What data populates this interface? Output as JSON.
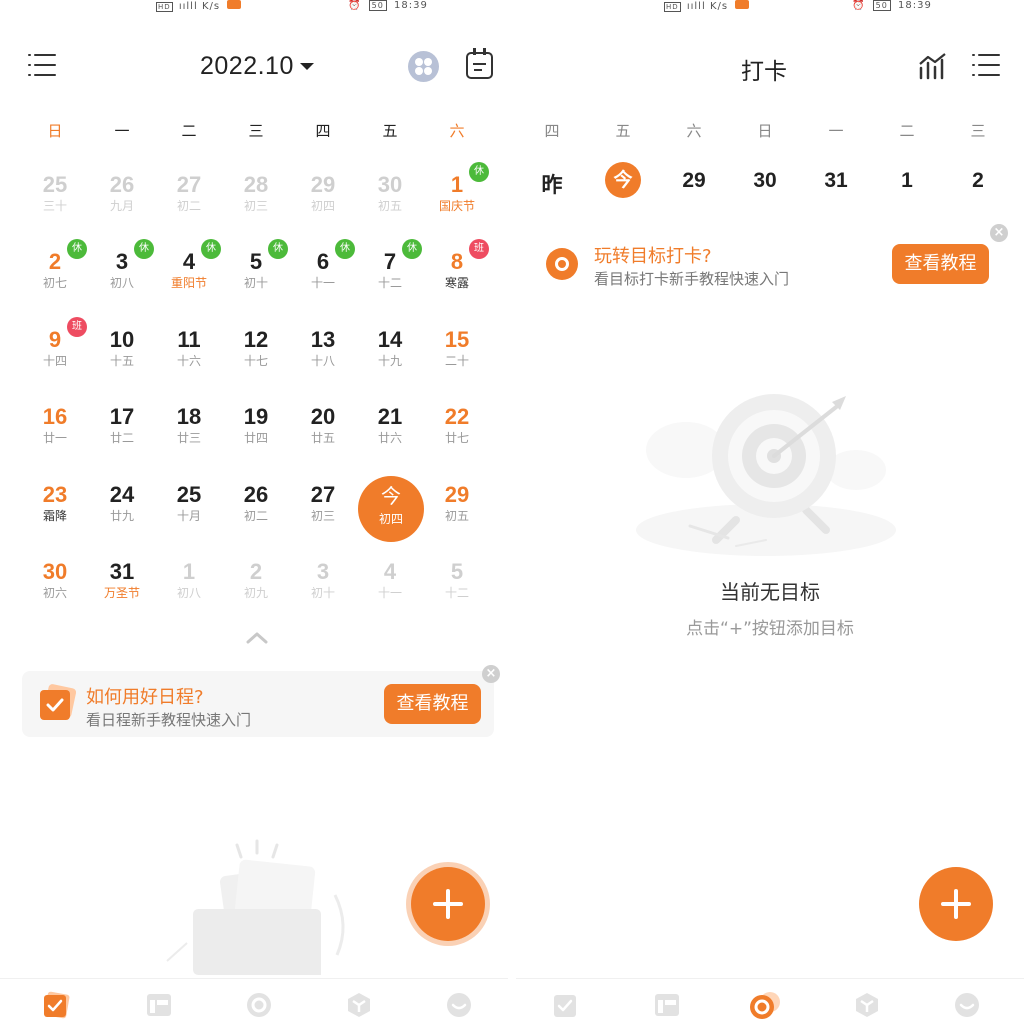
{
  "left": {
    "status": {
      "hd": "HD",
      "signal": "ıılll",
      "speed": "K/s",
      "battery": "50",
      "time": "18:39"
    },
    "header": {
      "month": "2022.10"
    },
    "weekdays": [
      "日",
      "一",
      "二",
      "三",
      "四",
      "五",
      "六"
    ],
    "weeks": [
      [
        {
          "n": "25",
          "s": "三十",
          "t": "other"
        },
        {
          "n": "26",
          "s": "九月",
          "t": "other"
        },
        {
          "n": "27",
          "s": "初二",
          "t": "other"
        },
        {
          "n": "28",
          "s": "初三",
          "t": "other"
        },
        {
          "n": "29",
          "s": "初四",
          "t": "other"
        },
        {
          "n": "30",
          "s": "初五",
          "t": "other"
        },
        {
          "n": "1",
          "s": "国庆节",
          "t": "weekend",
          "hl": true,
          "badge": "休"
        }
      ],
      [
        {
          "n": "2",
          "s": "初七",
          "t": "weekend",
          "badge": "休"
        },
        {
          "n": "3",
          "s": "初八",
          "t": "",
          "badge": "休"
        },
        {
          "n": "4",
          "s": "重阳节",
          "t": "",
          "hl": true,
          "badge": "休"
        },
        {
          "n": "5",
          "s": "初十",
          "t": "",
          "badge": "休"
        },
        {
          "n": "6",
          "s": "十一",
          "t": "",
          "badge": "休"
        },
        {
          "n": "7",
          "s": "十二",
          "t": "",
          "badge": "休"
        },
        {
          "n": "8",
          "s": "寒露",
          "t": "weekend",
          "term": true,
          "badge": "班",
          "badgeType": "work"
        }
      ],
      [
        {
          "n": "9",
          "s": "十四",
          "t": "weekend",
          "badge": "班",
          "badgeType": "work"
        },
        {
          "n": "10",
          "s": "十五",
          "t": ""
        },
        {
          "n": "11",
          "s": "十六",
          "t": ""
        },
        {
          "n": "12",
          "s": "十七",
          "t": ""
        },
        {
          "n": "13",
          "s": "十八",
          "t": ""
        },
        {
          "n": "14",
          "s": "十九",
          "t": ""
        },
        {
          "n": "15",
          "s": "二十",
          "t": "weekend"
        }
      ],
      [
        {
          "n": "16",
          "s": "廿一",
          "t": "weekend"
        },
        {
          "n": "17",
          "s": "廿二",
          "t": ""
        },
        {
          "n": "18",
          "s": "廿三",
          "t": ""
        },
        {
          "n": "19",
          "s": "廿四",
          "t": ""
        },
        {
          "n": "20",
          "s": "廿五",
          "t": ""
        },
        {
          "n": "21",
          "s": "廿六",
          "t": ""
        },
        {
          "n": "22",
          "s": "廿七",
          "t": "weekend"
        }
      ],
      [
        {
          "n": "23",
          "s": "霜降",
          "t": "weekend",
          "term": true
        },
        {
          "n": "24",
          "s": "廿九",
          "t": ""
        },
        {
          "n": "25",
          "s": "十月",
          "t": ""
        },
        {
          "n": "26",
          "s": "初二",
          "t": ""
        },
        {
          "n": "27",
          "s": "初三",
          "t": ""
        },
        {
          "n": "今",
          "s": "初四",
          "t": "today"
        },
        {
          "n": "29",
          "s": "初五",
          "t": "weekend"
        }
      ],
      [
        {
          "n": "30",
          "s": "初六",
          "t": "weekend"
        },
        {
          "n": "31",
          "s": "万圣节",
          "t": "",
          "hl": true
        },
        {
          "n": "1",
          "s": "初八",
          "t": "other"
        },
        {
          "n": "2",
          "s": "初九",
          "t": "other"
        },
        {
          "n": "3",
          "s": "初十",
          "t": "other"
        },
        {
          "n": "4",
          "s": "十一",
          "t": "other"
        },
        {
          "n": "5",
          "s": "十二",
          "t": "other"
        }
      ]
    ],
    "tip": {
      "title": "如何用好日程?",
      "subtitle": "看日程新手教程快速入门",
      "button": "查看教程"
    }
  },
  "right": {
    "status": {
      "hd": "HD",
      "signal": "ıılll",
      "speed": "K/s",
      "battery": "50",
      "time": "18:39"
    },
    "header": {
      "title": "打卡"
    },
    "weekdays": [
      "四",
      "五",
      "六",
      "日",
      "一",
      "二",
      "三"
    ],
    "days": [
      "昨",
      "今",
      "29",
      "30",
      "31",
      "1",
      "2"
    ],
    "tip": {
      "title": "玩转目标打卡?",
      "subtitle": "看目标打卡新手教程快速入门",
      "button": "查看教程"
    },
    "empty": {
      "title": "当前无目标",
      "subtitle": "点击“+”按钮添加目标"
    }
  },
  "colors": {
    "accent": "#f07c2a",
    "rest_badge": "#4cba3a",
    "work_badge": "#ee4c61"
  }
}
